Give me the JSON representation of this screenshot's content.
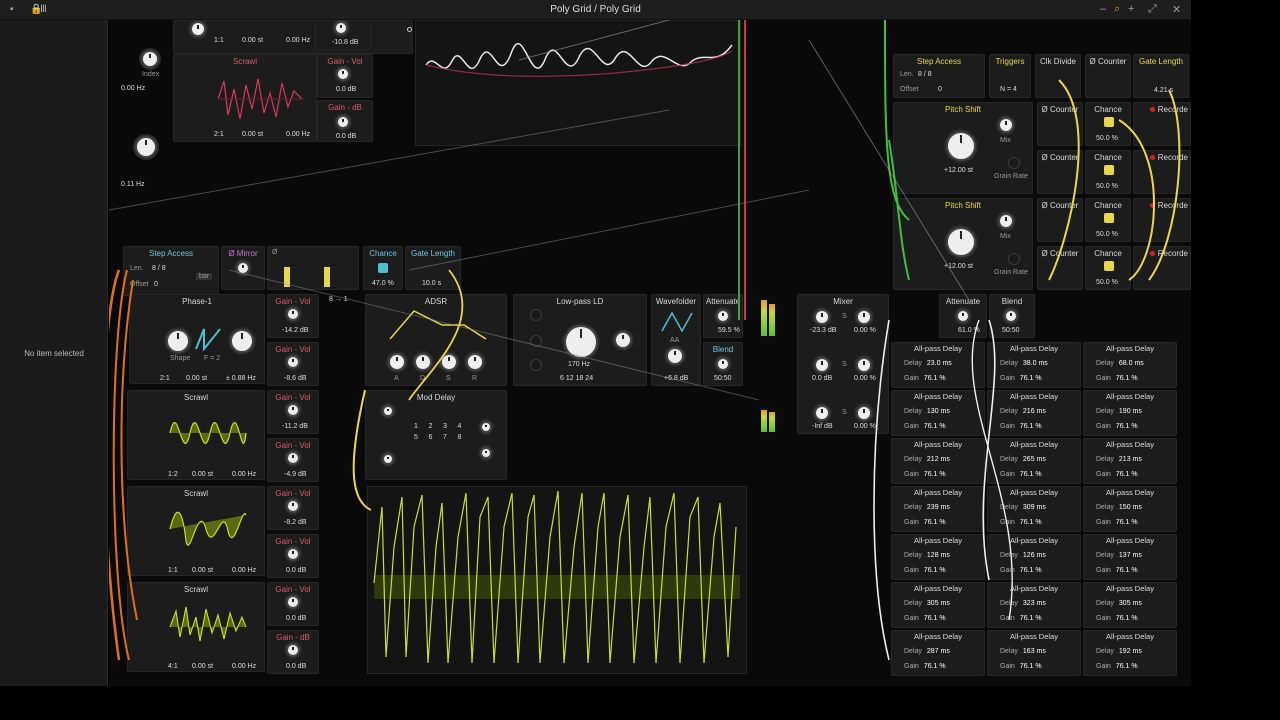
{
  "window": {
    "title": "Poly Grid / Poly Grid"
  },
  "sidebar": {
    "empty_text": "No item selected"
  },
  "top": {
    "row1": {
      "ratio": "1:1",
      "st": "0.00  st",
      "hz": "0.00 Hz",
      "db": "-10.8 dB"
    },
    "index_label": "Index",
    "left_hz1": "0.00 Hz",
    "left_st": "st",
    "scrawl": "Scrawl",
    "gain_vol": "Gain - Vol",
    "vol_db": "0.0 dB",
    "gain_db": "Gain - dB",
    "gain_db_val": "0.0 dB",
    "row2": {
      "ratio": "2:1",
      "st": "0.00  st",
      "hz": "0.00 Hz"
    },
    "left_hz2": "0.11 Hz"
  },
  "seq": {
    "step_access": "Step Access",
    "len": "Len.",
    "len_val": "8 / 8",
    "offset": "Offset",
    "offset_val": "0",
    "bar": "bar",
    "mirror": "Ø Mirror",
    "phi": "Ø",
    "chance": "Chance",
    "chance_val": "47.0 %",
    "gate_length": "Gate Length",
    "gate_val": "10.0 s"
  },
  "phase_row": {
    "phase": "Phase-1",
    "shape": "Shape",
    "f": "F = 2",
    "ratio": "2:1",
    "st": "0.00  st",
    "hz": "± 0.88 Hz",
    "gain_vol": "Gain - Vol",
    "ratio_sel": "8 → 1",
    "db1": "-14.2 dB",
    "db2": "-8.6 dB"
  },
  "adsr": {
    "title": "ADSR",
    "a": "A",
    "d": "D",
    "s": "S",
    "r": "R"
  },
  "lpf": {
    "title": "Low-pass LD",
    "freq": "170 Hz",
    "slopes": "6  12 18 24",
    "aa": "AA"
  },
  "wavefolder": {
    "title": "Wavefolder",
    "db": "+6.8 dB"
  },
  "attenuate1": {
    "title": "Attenuate",
    "val": "59.5 %"
  },
  "blend1": {
    "title": "Blend",
    "val": "50:50"
  },
  "mixer": {
    "title": "Mixer",
    "rows": [
      {
        "db": "-23.3 dB",
        "pan": "0.00 %"
      },
      {
        "db": "0.0 dB",
        "pan": "0.00 %"
      },
      {
        "db": "-Inf dB",
        "pan": "0.00 %"
      }
    ],
    "s": "S"
  },
  "moddelay": {
    "title": "Mod Delay",
    "grid": [
      "1",
      "2",
      "3",
      "4",
      "5",
      "6",
      "7",
      "8"
    ]
  },
  "scrawls": [
    {
      "title": "Scrawl",
      "ratio": "1:2",
      "st": "0.00  st",
      "hz": "0.00 Hz",
      "gv": "Gain - Vol",
      "db1": "-11.2 dB",
      "db2": "-4.9 dB"
    },
    {
      "title": "Scrawl",
      "ratio": "1:1",
      "st": "0.00  st",
      "hz": "0.00 Hz",
      "gv": "Gain - Vol",
      "db1": "-8.2 dB",
      "db2": "0.0 dB"
    },
    {
      "title": "Scrawl",
      "ratio": "4:1",
      "st": "0.00  st",
      "hz": "0.00 Hz",
      "gv": "Gain - Vol",
      "db1": "0.0 dB",
      "gdb": "Gain - dB",
      "db2": "0.0 dB"
    }
  ],
  "right_top": {
    "step_access": "Step Access",
    "len": "Len.",
    "len_val": "8 / 8",
    "offset": "Offset",
    "offset_val": "0",
    "triggers": "Triggers",
    "n": "N = 4",
    "clk": "Clk Divide",
    "counter": "Ø Counter",
    "gate_length": "Gate Length",
    "gate_val": "4.21 s"
  },
  "pitch": [
    {
      "title": "Pitch Shift",
      "st": "+12.00 st",
      "mix": "Mix",
      "grain": "Grain Rate"
    },
    {
      "title": "Pitch Shift",
      "st": "+12.00 st",
      "mix": "Mix",
      "grain": "Grain Rate"
    }
  ],
  "counters": {
    "counter": "Ø Counter",
    "chance": "Chance",
    "pct": "50.0 %",
    "recorder": "Recorde"
  },
  "attenuate2": {
    "title": "Attenuate",
    "val": "61.0 %"
  },
  "blend2": {
    "title": "Blend",
    "val": "50:50"
  },
  "allpass": {
    "title": "All-pass Delay",
    "delay": "Delay",
    "gain": "Gain",
    "gain_val": "76.1 %",
    "cols": [
      [
        "23.0 ms",
        "130 ms",
        "212 ms",
        "239 ms",
        "128 ms",
        "305 ms",
        "287 ms"
      ],
      [
        "38.0 ms",
        "216 ms",
        "265 ms",
        "309 ms",
        "126 ms",
        "323 ms",
        "163 ms"
      ],
      [
        "68.0 ms",
        "190 ms",
        "213 ms",
        "150 ms",
        "137 ms",
        "305 ms",
        "192 ms"
      ]
    ]
  }
}
